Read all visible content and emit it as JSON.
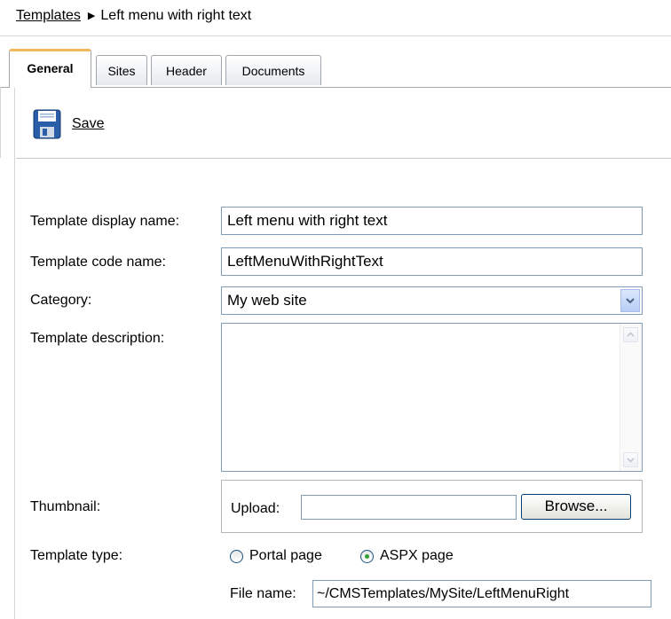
{
  "breadcrumb": {
    "root_link": "Templates",
    "current": "Left menu with right text"
  },
  "tabs": [
    {
      "label": "General",
      "active": true
    },
    {
      "label": "Sites",
      "active": false
    },
    {
      "label": "Header",
      "active": false
    },
    {
      "label": "Documents",
      "active": false
    }
  ],
  "toolbar": {
    "save_label": "Save",
    "save_icon": "floppy-disk-icon"
  },
  "form": {
    "display_name": {
      "label": "Template display name:",
      "value": "Left menu with right text"
    },
    "code_name": {
      "label": "Template code name:",
      "value": "LeftMenuWithRightText"
    },
    "category": {
      "label": "Category:",
      "value": "My web site"
    },
    "description": {
      "label": "Template description:",
      "value": ""
    },
    "thumbnail": {
      "label": "Thumbnail:",
      "upload_label": "Upload:",
      "upload_value": "",
      "browse_label": "Browse..."
    },
    "template_type": {
      "label": "Template type:",
      "options": [
        {
          "label": "Portal page",
          "selected": false
        },
        {
          "label": "ASPX page",
          "selected": true
        }
      ]
    },
    "file_name": {
      "label": "File name:",
      "value": "~/CMSTemplates/MySite/LeftMenuRight"
    }
  },
  "colors": {
    "active_tab_accent": "#f3b85c",
    "input_border": "#7f9db9"
  }
}
